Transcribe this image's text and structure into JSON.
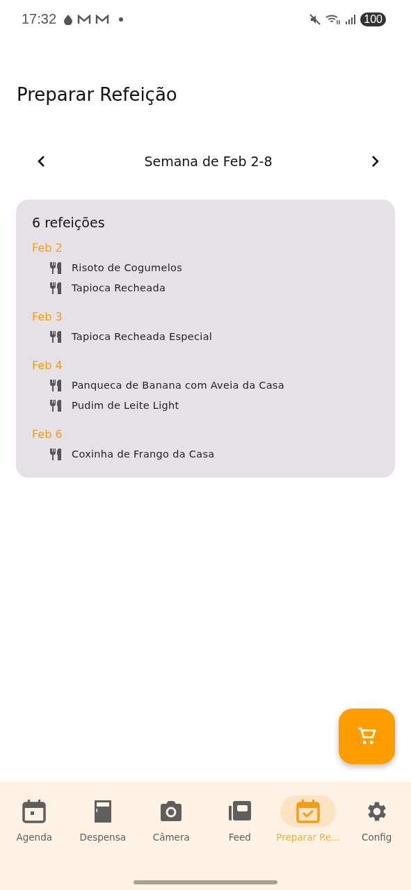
{
  "status_bar": {
    "time": "17:32",
    "battery": "100"
  },
  "title": "Preparar Refeição",
  "week": {
    "label": "Semana de Feb 2-8"
  },
  "summary": {
    "count": "6 refeições",
    "days": [
      {
        "date": "Feb 2",
        "meals": [
          "Risoto de Cogumelos",
          "Tapioca Recheada"
        ]
      },
      {
        "date": "Feb 3",
        "meals": [
          "Tapioca Recheada Especial"
        ]
      },
      {
        "date": "Feb 4",
        "meals": [
          "Panqueca de Banana com Aveia da Casa",
          "Pudim de Leite Light"
        ]
      },
      {
        "date": "Feb 6",
        "meals": [
          "Coxinha de Frango da Casa"
        ]
      }
    ]
  },
  "nav": [
    {
      "label": "Agenda",
      "kind": "calendar",
      "selected": false
    },
    {
      "label": "Despensa",
      "kind": "fridge",
      "selected": false
    },
    {
      "label": "Câmera",
      "kind": "camera",
      "selected": false
    },
    {
      "label": "Feed",
      "kind": "feed",
      "selected": false
    },
    {
      "label": "Preparar Re...",
      "kind": "check",
      "selected": true
    },
    {
      "label": "Config",
      "kind": "gear",
      "selected": false
    }
  ]
}
